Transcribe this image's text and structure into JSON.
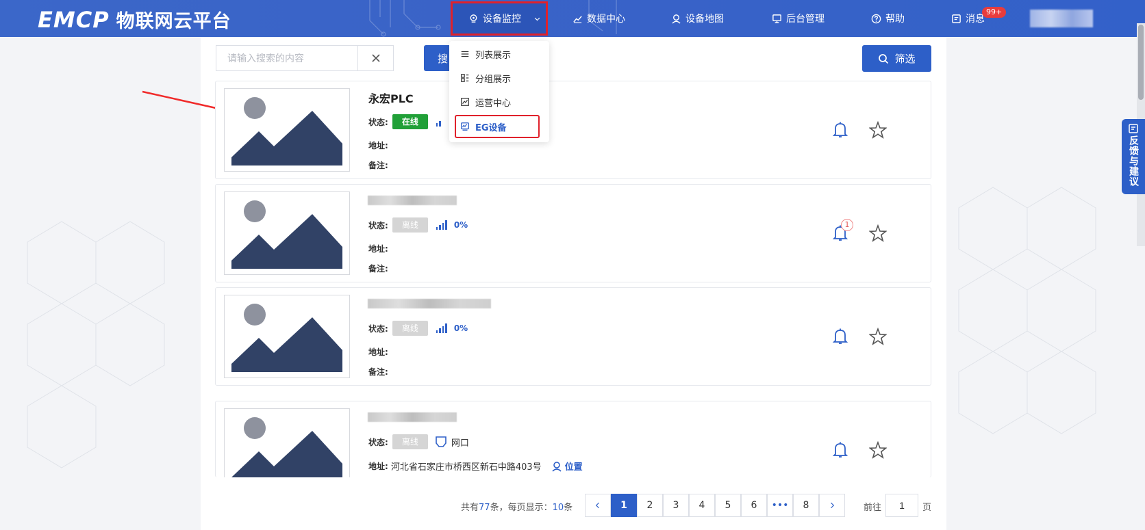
{
  "app": {
    "logo_mark": "EMCP",
    "logo_text": "物联网云平台"
  },
  "nav": {
    "items": [
      {
        "label": "设备监控",
        "icon": "location-pin-icon"
      },
      {
        "label": "数据中心",
        "icon": "chart-icon"
      },
      {
        "label": "设备地图",
        "icon": "map-pin-icon"
      },
      {
        "label": "后台管理",
        "icon": "monitor-icon"
      },
      {
        "label": "帮助",
        "icon": "question-icon"
      },
      {
        "label": "消息",
        "icon": "message-icon"
      }
    ],
    "message_badge": "99+"
  },
  "dropdown": {
    "items": [
      {
        "label": "列表展示",
        "icon": "list-icon"
      },
      {
        "label": "分组展示",
        "icon": "group-icon"
      },
      {
        "label": "运营中心",
        "icon": "operation-icon"
      },
      {
        "label": "EG设备",
        "icon": "eg-device-icon"
      }
    ]
  },
  "search": {
    "placeholder": "请输入搜索的内容",
    "button_label": "搜",
    "filter_label": "筛选"
  },
  "labels": {
    "status": "状态:",
    "address": "地址:",
    "note": "备注:",
    "location": "位置"
  },
  "devices": [
    {
      "name": "永宏PLC",
      "status": "在线",
      "status_color": "#21a038",
      "signal": "",
      "address": "",
      "note": "",
      "alarm_count": ""
    },
    {
      "name": "",
      "status": "离线",
      "status_color": "#d5d5d5",
      "signal": "0%",
      "address": "",
      "note": "",
      "alarm_count": "1"
    },
    {
      "name": "",
      "status": "离线",
      "status_color": "#d5d5d5",
      "signal": "0%",
      "address": "",
      "note": "",
      "alarm_count": ""
    },
    {
      "name": "",
      "status": "离线",
      "status_color": "#d5d5d5",
      "network": "网口",
      "address": "河北省石家庄市桥西区新石中路403号",
      "note": "",
      "alarm_count": ""
    }
  ],
  "pagination": {
    "total_prefix": "共有",
    "total": "77",
    "total_mid": "条，每页显示：",
    "per_page": "10",
    "per_page_suffix": "条",
    "pages": [
      "1",
      "2",
      "3",
      "4",
      "5",
      "6",
      "•••",
      "8"
    ],
    "current": "1",
    "goto_label": "前往",
    "goto_value": "1",
    "goto_suffix": "页"
  },
  "feedback": {
    "label": "反馈与建议"
  },
  "colors": {
    "primary": "#2d5fc8",
    "topbar": "#3a63c7",
    "highlight": "#e0212b",
    "online": "#21a038"
  }
}
